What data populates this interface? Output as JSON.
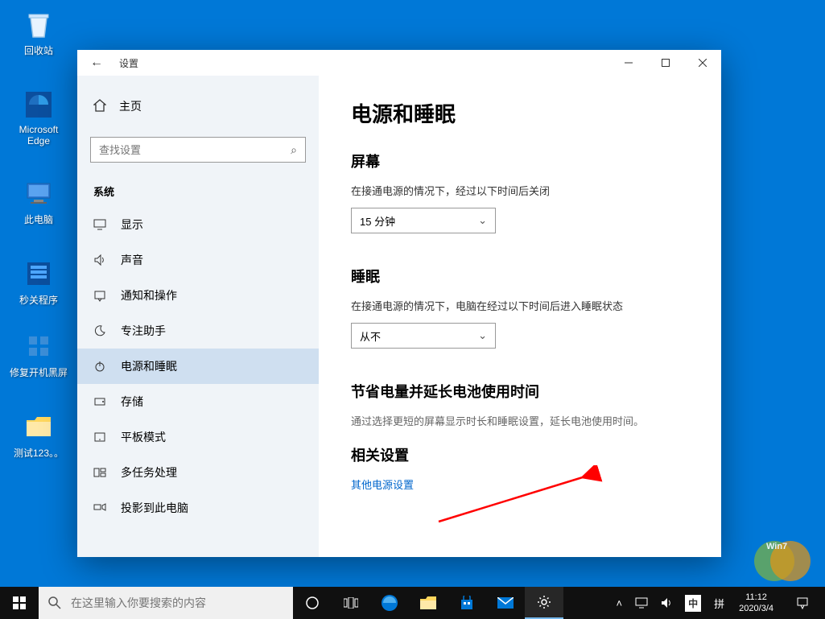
{
  "desktop": {
    "icons": [
      {
        "label": "回收站"
      },
      {
        "label": "Microsoft Edge"
      },
      {
        "label": "此电脑"
      },
      {
        "label": "秒关程序"
      },
      {
        "label": "修复开机黑屏"
      },
      {
        "label": "测试123。。"
      }
    ]
  },
  "window": {
    "title": "设置",
    "home_label": "主页",
    "search_placeholder": "查找设置",
    "category": "系统",
    "nav": [
      {
        "label": "显示"
      },
      {
        "label": "声音"
      },
      {
        "label": "通知和操作"
      },
      {
        "label": "专注助手"
      },
      {
        "label": "电源和睡眠"
      },
      {
        "label": "存储"
      },
      {
        "label": "平板模式"
      },
      {
        "label": "多任务处理"
      },
      {
        "label": "投影到此电脑"
      }
    ],
    "content": {
      "heading": "电源和睡眠",
      "screen_heading": "屏幕",
      "screen_desc": "在接通电源的情况下，经过以下时间后关闭",
      "screen_value": "15 分钟",
      "sleep_heading": "睡眠",
      "sleep_desc": "在接通电源的情况下，电脑在经过以下时间后进入睡眠状态",
      "sleep_value": "从不",
      "save_heading": "节省电量并延长电池使用时间",
      "save_desc": "通过选择更短的屏幕显示时长和睡眠设置，延长电池使用时间。",
      "related_heading": "相关设置",
      "related_link": "其他电源设置"
    }
  },
  "taskbar": {
    "search_placeholder": "在这里输入你要搜索的内容",
    "ime": "中",
    "ime2": "拼",
    "time": "11:12",
    "date": "2020/3/4"
  }
}
